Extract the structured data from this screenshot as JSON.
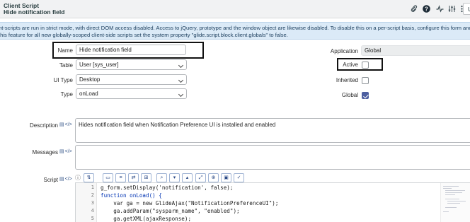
{
  "header": {
    "record_type": "Client Script",
    "record_name": "Hide notification field",
    "icons": [
      "paperclip-icon",
      "help-icon",
      "activity-icon",
      "settings-icon",
      "more-icon"
    ],
    "button_label": "U"
  },
  "banner": {
    "line1": "nt-scripts are run in strict mode, with direct DOM access disabled. Access to jQuery, prototype and the window object are likewise disabled. To disable this on a per-script basis, configure this form and add",
    "line2": "this feature for all new globally-scoped client-side scripts set the system property \"glide.script.block.client.globals\" to false."
  },
  "form": {
    "name_label": "Name",
    "name_value": "Hide notification field",
    "table_label": "Table",
    "table_value": "User [sys_user]",
    "uitype_label": "UI Type",
    "uitype_value": "Desktop",
    "type_label": "Type",
    "type_value": "onLoad",
    "application_label": "Application",
    "application_value": "Global",
    "active_label": "Active",
    "active_checked": false,
    "inherited_label": "Inherited",
    "inherited_checked": false,
    "global_label": "Global",
    "global_checked": true,
    "description_label": "Description",
    "description_value": "Hides notification field when Notification Preference UI is installed and enabled",
    "messages_label": "Messages",
    "messages_value": "",
    "script_label": "Script"
  },
  "script_toolbar_icons": [
    "toggle-syntax-icon",
    "comment-icon",
    "format-icon",
    "replace-icon",
    "script-search-icon",
    "find-next-icon",
    "find-prev-icon",
    "fullscreen-icon",
    "debug-icon",
    "save-icon",
    "check-syntax-icon"
  ],
  "script": {
    "line_numbers": [
      "1",
      "2",
      "3",
      "4",
      "5"
    ],
    "lines": [
      "g_form.setDisplay('notification', false);",
      "function onLoad() {",
      "    var ga = new GlideAjax(\"NotificationPreferenceUI\");",
      "    ga.addParam(\"sysparm_name\", \"enabled\");",
      "    ga.getXML(ajaxResponse);"
    ]
  },
  "colors": {
    "header_bg": "#f1f2f3",
    "banner_bg": "#dbeaf7",
    "checkbox_checked": "#4d5fa0",
    "highlight_border": "#111111"
  }
}
